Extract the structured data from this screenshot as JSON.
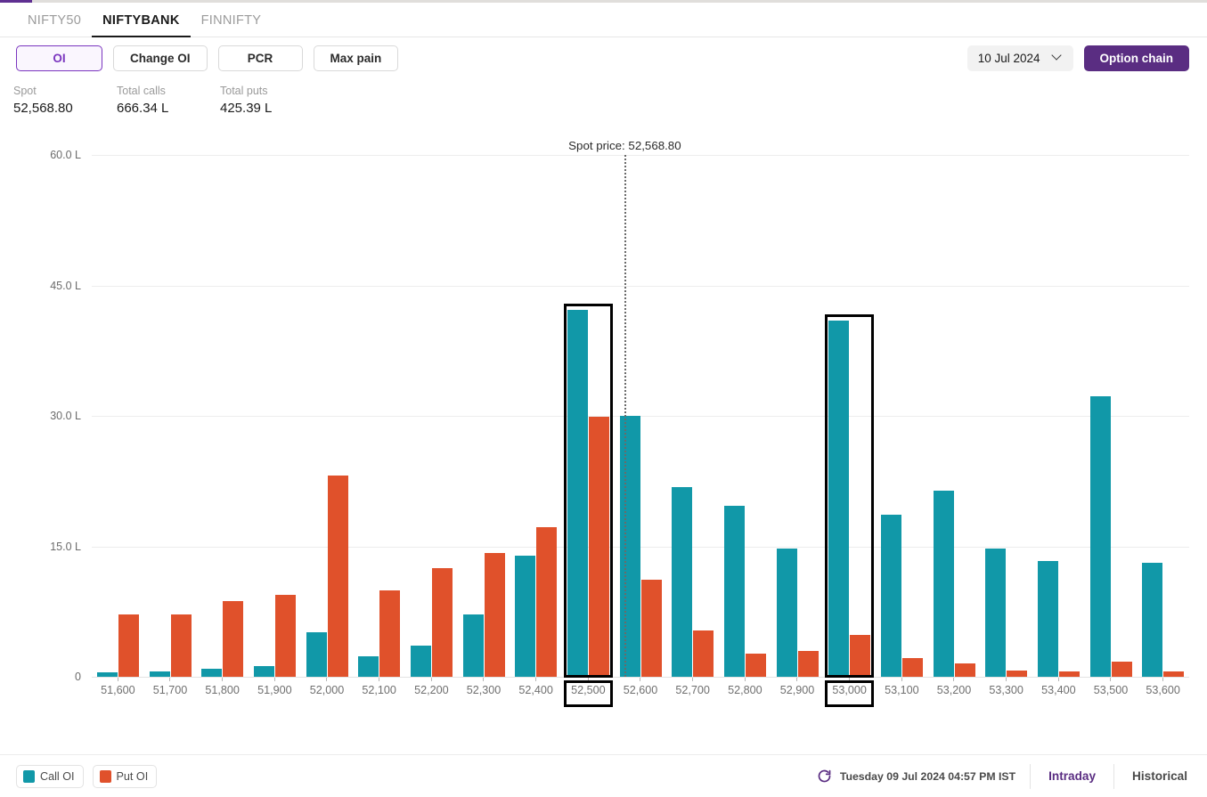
{
  "progress": {
    "percent": 3
  },
  "index_tabs": [
    {
      "label": "NIFTY50",
      "active": false
    },
    {
      "label": "NIFTYBANK",
      "active": true
    },
    {
      "label": "FINNIFTY",
      "active": false
    }
  ],
  "metric_buttons": [
    {
      "label": "OI",
      "active": true
    },
    {
      "label": "Change OI",
      "active": false
    },
    {
      "label": "PCR",
      "active": false
    },
    {
      "label": "Max pain",
      "active": false
    }
  ],
  "expiry": {
    "value": "10 Jul 2024",
    "icon": "chevron-down-icon"
  },
  "option_chain_button": {
    "label": "Option chain"
  },
  "stats": [
    {
      "label": "Spot",
      "value": "52,568.80"
    },
    {
      "label": "Total calls",
      "value": "666.34 L"
    },
    {
      "label": "Total puts",
      "value": "425.39 L"
    }
  ],
  "legend": [
    {
      "label": "Call OI",
      "color": "#1198a8"
    },
    {
      "label": "Put OI",
      "color": "#e0512b"
    }
  ],
  "footer": {
    "refresh_icon": "refresh-icon",
    "timestamp": "Tuesday 09 Jul 2024 04:57 PM IST",
    "intraday_label": "Intraday",
    "historical_label": "Historical"
  },
  "colors": {
    "call": "#1198a8",
    "put": "#e0512b",
    "accent": "#5a2d82",
    "accent_light": "#7a35bf",
    "highlight": "#000000"
  },
  "chart_data": {
    "type": "bar",
    "title": "",
    "xlabel": "",
    "ylabel": "",
    "ylim": [
      0,
      60
    ],
    "yticks": [
      0,
      15,
      30,
      45,
      60
    ],
    "ytick_labels": [
      "0",
      "15.0 L",
      "30.0 L",
      "45.0 L",
      "60.0 L"
    ],
    "unit": "L",
    "grid": true,
    "legend_position": "bottom-left",
    "categories": [
      "51,600",
      "51,700",
      "51,800",
      "51,900",
      "52,000",
      "52,100",
      "52,200",
      "52,300",
      "52,400",
      "52,500",
      "52,600",
      "52,700",
      "52,800",
      "52,900",
      "53,000",
      "53,100",
      "53,200",
      "53,300",
      "53,400",
      "53,500",
      "53,600"
    ],
    "series": [
      {
        "name": "Call OI",
        "color": "#1198a8",
        "values": [
          0.5,
          0.6,
          0.9,
          1.2,
          5.1,
          2.4,
          3.6,
          7.2,
          13.9,
          42.2,
          30.0,
          21.8,
          19.7,
          14.7,
          41.0,
          18.6,
          21.4,
          14.7,
          13.3,
          32.3,
          13.1
        ]
      },
      {
        "name": "Put OI",
        "color": "#e0512b",
        "values": [
          7.2,
          7.2,
          8.7,
          9.4,
          23.1,
          9.9,
          12.5,
          14.2,
          17.2,
          29.9,
          11.2,
          5.3,
          2.7,
          3.0,
          4.8,
          2.2,
          1.5,
          0.7,
          0.6,
          1.7,
          0.6
        ]
      }
    ],
    "annotations": [
      {
        "type": "vline",
        "label": "Spot price: 52,568.80",
        "value": 52568.8,
        "x_index": 10.2
      }
    ],
    "highlighted_categories": [
      "52,500",
      "53,000"
    ]
  }
}
